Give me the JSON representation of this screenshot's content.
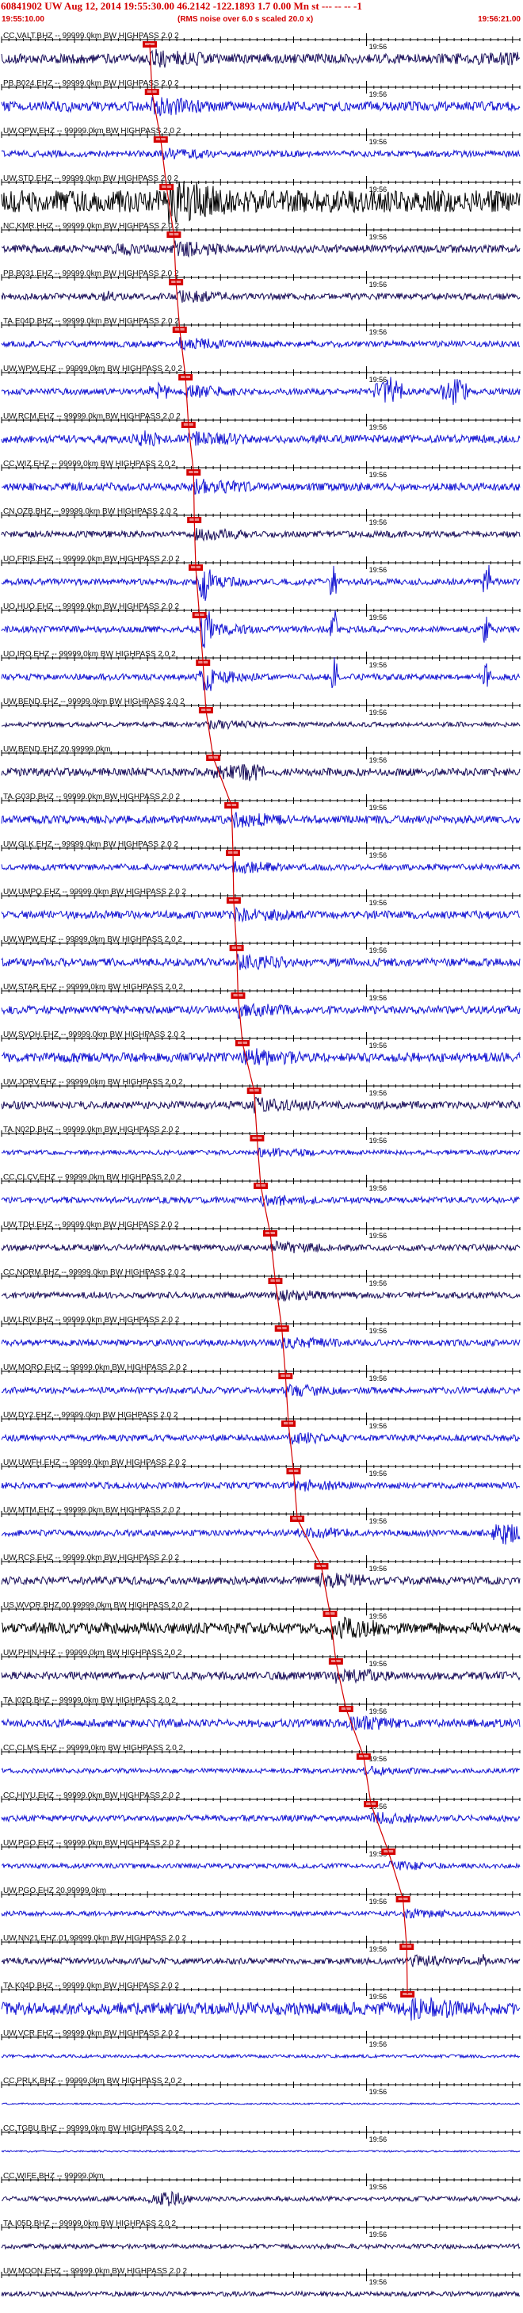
{
  "header": {
    "title": "60841902 UW Aug 12, 2014 19:55:30.00   46.2142 -122.1893  1.7 0.00 Mn st --- -- -- -1",
    "start_time": "19:55:10.00",
    "end_time": "19:56:21.00",
    "note": "(RMS noise over 6.0 s scaled 20.0 x)"
  },
  "colors": {
    "trace_primary": "#1414d2",
    "trace_dark": "#1a0f5a",
    "trace_black": "#000000",
    "pick": "#d40000",
    "axis": "#000000",
    "background": "#ffffff"
  },
  "chart_data": {
    "type": "seismogram-record-section",
    "title": "60841902 UW Aug 12, 2014 19:55:30.00   46.2142 -122.1893  1.7 0.00 Mn st --- -- -- -1",
    "x_range": [
      "19:55:10.00",
      "19:56:21.00"
    ],
    "minute_mark": "19:56",
    "grid": false,
    "channels": [
      {
        "label": "CC.VALT.BHZ -- 99999.0km BW  HIGHPASS  2.0  2",
        "pick": "19:55:30.3",
        "pick_label": "",
        "style": "dark",
        "amplitude": 6,
        "bursts": [
          [
            50,
            95,
            9
          ]
        ]
      },
      {
        "label": "PB.B024.EHZ -- 99999.0km BW  HIGHPASS  2.0  2",
        "pick": "19:55:30.6",
        "pick_label": "",
        "style": "blue",
        "amplitude": 6,
        "bursts": [
          [
            6,
            12,
            8
          ]
        ]
      },
      {
        "label": "UW.OPW.EHZ -- 99999.0km BW  HIGHPASS  2.0  2",
        "pick": "19:55:31.8",
        "pick_label": "",
        "style": "blue",
        "amplitude": 4,
        "bursts": [
          [
            80,
            90,
            8
          ]
        ]
      },
      {
        "label": "UW.STD.EHZ -- 99999.0km BW  HIGHPASS  2.0  2",
        "pick": "19:55:32.6",
        "pick_label": "",
        "style": "black",
        "amplitude": 14,
        "bursts": []
      },
      {
        "label": "NC.KMR.HHZ -- 99999.0km BW  HIGHPASS  2.0  2",
        "pick": "19:55:33.6",
        "pick_label": "",
        "style": "dark",
        "amplitude": 5,
        "bursts": [
          [
            14,
            20,
            9
          ]
        ]
      },
      {
        "label": "PB.B031.EHZ -- 99999.0km BW  HIGHPASS  2.0  2",
        "pick": "19:55:33.9",
        "pick_label": "",
        "style": "dark",
        "amplitude": 4,
        "bursts": [
          [
            13,
            16,
            8
          ]
        ]
      },
      {
        "label": "TA.E04D.BHZ -- 99999.0km BW  HIGHPASS  2.0  2",
        "pick": "19:55:34.4",
        "pick_label": "",
        "style": "blue",
        "amplitude": 4,
        "bursts": []
      },
      {
        "label": "UW.WPW.EHZ -- 99999.0km BW  HIGHPASS  2.0  2",
        "pick": "19:55:35.2",
        "pick_label": "",
        "style": "blue",
        "amplitude": 4,
        "bursts": [
          [
            20,
            23,
            14
          ],
          [
            51,
            55,
            20
          ],
          [
            60,
            64,
            18
          ]
        ]
      },
      {
        "label": "UW.RCM.EHZ -- 99999.0km BW  HIGHPASS  2.0  2",
        "pick": "19:55:35.6",
        "pick_label": "",
        "style": "blue",
        "amplitude": 5,
        "bursts": [
          [
            18,
            22,
            12
          ]
        ]
      },
      {
        "label": "CC.WIZ.EHZ -- 99999.0km BW  HIGHPASS  2.0  2",
        "pick": "19:55:36.3",
        "pick_label": "",
        "style": "blue",
        "amplitude": 5,
        "bursts": []
      },
      {
        "label": "CN.OZB.BHZ -- 99999.0km BW  HIGHPASS  2.0  2",
        "pick": "19:55:36.4",
        "pick_label": "",
        "style": "dark",
        "amplitude": 4,
        "bursts": []
      },
      {
        "label": "UO.FRIS.EHZ -- 99999.0km BW  HIGHPASS  2.0  2",
        "pick": "19:55:36.6",
        "pick_label": "",
        "style": "blue",
        "amplitude": 4,
        "bursts": [
          [
            27,
            29,
            30
          ],
          [
            45,
            46,
            30
          ],
          [
            66,
            67,
            30
          ]
        ]
      },
      {
        "label": "UO.HUO.EHZ -- 99999.0km BW  HIGHPASS  2.0  2",
        "pick": "19:55:37.1",
        "pick_label": "",
        "style": "blue",
        "amplitude": 4,
        "bursts": [
          [
            27,
            29,
            30
          ],
          [
            45,
            46,
            30
          ],
          [
            66,
            67,
            30
          ]
        ]
      },
      {
        "label": "UO.IRO.EHZ -- 99999.0km BW  HIGHPASS  2.0  2",
        "pick": "19:55:37.6",
        "pick_label": "",
        "style": "blue",
        "amplitude": 4,
        "bursts": [
          [
            27,
            29,
            30
          ],
          [
            45,
            46,
            30
          ],
          [
            66,
            67,
            30
          ]
        ]
      },
      {
        "label": "UW.BEND.EHZ -- 99999.0km BW  HIGHPASS  2.0  2",
        "pick": "19:55:38.0",
        "pick_label": "",
        "style": "dark",
        "amplitude": 3,
        "bursts": []
      },
      {
        "label": "UW.BEND.EHZ 20.99999.0km",
        "pick": "19:55:39.0",
        "pick_label": "",
        "style": "dark",
        "amplitude": 5,
        "bursts": [
          [
            32,
            36,
            14
          ]
        ]
      },
      {
        "label": "TA.G03D.BHZ -- 99999.0km BW  HIGHPASS  2.0  2",
        "pick": "19:55:41.5",
        "pick_label": "",
        "style": "blue",
        "amplitude": 5,
        "bursts": []
      },
      {
        "label": "UW.GLK.EHZ -- 99999.0km BW  HIGHPASS  2.0  2",
        "pick": "19:55:41.7",
        "pick_label": "",
        "style": "blue",
        "amplitude": 4,
        "bursts": []
      },
      {
        "label": "UW.UMPQ.EHZ -- 99999.0km BW  HIGHPASS  2.0  2",
        "pick": "19:55:41.8",
        "pick_label": "",
        "style": "blue",
        "amplitude": 5,
        "bursts": []
      },
      {
        "label": "UW.WPW.EHZ -- 99999.0km BW  HIGHPASS  2.0  2",
        "pick": "19:55:42.2",
        "pick_label": "",
        "style": "blue",
        "amplitude": 5,
        "bursts": []
      },
      {
        "label": "UW.STAR.EHZ -- 99999.0km BW  HIGHPASS  2.0  2",
        "pick": "19:55:42.4",
        "pick_label": "",
        "style": "blue",
        "amplitude": 5,
        "bursts": []
      },
      {
        "label": "UW.SVOH.EHZ -- 99999.0km BW  HIGHPASS  2.0  2",
        "pick": "19:55:43.0",
        "pick_label": "",
        "style": "blue",
        "amplitude": 6,
        "bursts": []
      },
      {
        "label": "UW.JORV.EHZ -- 99999.0km BW  HIGHPASS  2.0  2",
        "pick": "19:55:44.6",
        "pick_label": "",
        "style": "dark",
        "amplitude": 5,
        "bursts": []
      },
      {
        "label": "TA.N02D.BHZ -- 99999.0km BW  HIGHPASS  2.0  2",
        "pick": "19:55:45.0",
        "pick_label": "",
        "style": "blue",
        "amplitude": 3,
        "bursts": []
      },
      {
        "label": "CC.CLCV.EHZ -- 99999.0km BW  HIGHPASS  2.0  2",
        "pick": "19:55:45.5",
        "pick_label": "",
        "style": "blue",
        "amplitude": 4,
        "bursts": []
      },
      {
        "label": "UW.TDH.EHZ -- 99999.0km BW  HIGHPASS  2.0  2",
        "pick": "19:55:46.8",
        "pick_label": "",
        "style": "dark",
        "amplitude": 4,
        "bursts": []
      },
      {
        "label": "CC.NORM.BHZ -- 99999.0km BW  HIGHPASS  2.0  2",
        "pick": "19:55:47.5",
        "pick_label": "",
        "style": "dark",
        "amplitude": 4,
        "bursts": []
      },
      {
        "label": "UW.LRIV.BHZ -- 99999.0km BW  HIGHPASS  2.0  2",
        "pick": "19:55:48.4",
        "pick_label": "",
        "style": "blue",
        "amplitude": 4,
        "bursts": []
      },
      {
        "label": "UW.MORO.EHZ -- 99999.0km BW  HIGHPASS  2.0  2",
        "pick": "19:55:48.9",
        "pick_label": "",
        "style": "blue",
        "amplitude": 4,
        "bursts": []
      },
      {
        "label": "UW.DY2.EHZ -- 99999.0km BW  HIGHPASS  2.0  2",
        "pick": "19:55:49.3",
        "pick_label": "",
        "style": "blue",
        "amplitude": 4,
        "bursts": []
      },
      {
        "label": "UW.UWFH.EHZ -- 99999.0km BW  HIGHPASS  2.0  2",
        "pick": "19:55:50.0",
        "pick_label": "",
        "style": "blue",
        "amplitude": 4,
        "bursts": []
      },
      {
        "label": "UW.MTM.EHZ -- 99999.0km BW  HIGHPASS  2.0  2",
        "pick": "19:55:50.5",
        "pick_label": "",
        "style": "blue",
        "amplitude": 4,
        "bursts": [
          [
            67,
            71,
            16
          ]
        ]
      },
      {
        "label": "UW.RCS.EHZ -- 99999.0km BW  HIGHPASS  2.0  2",
        "pick": "19:55:53.8",
        "pick_label": "",
        "style": "dark",
        "amplitude": 5,
        "bursts": [
          [
            43,
            47,
            12
          ]
        ]
      },
      {
        "label": "US.WVOR.BHZ.00.99999.0km BW  HIGHPASS  2.0  2",
        "pick": "19:55:55.0",
        "pick_label": "",
        "style": "black",
        "amplitude": 7,
        "bursts": []
      },
      {
        "label": "UW.PHIN.HHZ -- 99999.0km BW  HIGHPASS  2.0  2",
        "pick": "19:55:55.8",
        "pick_label": "",
        "style": "dark",
        "amplitude": 5,
        "bursts": []
      },
      {
        "label": "TA.I02D.BHZ -- 99999.0km BW  HIGHPASS  2.0  2",
        "pick": "19:55:57.2",
        "pick_label": "",
        "style": "blue",
        "amplitude": 5,
        "bursts": []
      },
      {
        "label": "CC.CLMS.EHZ -- 99999.0km BW  HIGHPASS  2.0  2",
        "pick": "19:55:59.6",
        "pick_label": "",
        "style": "blue",
        "amplitude": 3,
        "bursts": []
      },
      {
        "label": "CC.HIYU.EHZ -- 99999.0km BW  HIGHPASS  2.0  2",
        "pick": "19:56:00.6",
        "pick_label": "",
        "style": "blue",
        "amplitude": 4,
        "bursts": []
      },
      {
        "label": "UW.PGO.EHZ -- 99999.0km BW  HIGHPASS  2.0  2",
        "pick": "19:56:03.0",
        "pick_label": "",
        "style": "blue",
        "amplitude": 3,
        "bursts": []
      },
      {
        "label": "UW.PGO.EHZ 20.99999.0km",
        "pick": "19:56:05.0",
        "pick_label": "",
        "style": "blue",
        "amplitude": 3,
        "bursts": []
      },
      {
        "label": "UW.NN21.EHZ.01.99999.0km BW  HIGHPASS  2.0  2",
        "pick": "19:56:05.5",
        "pick_label": "",
        "style": "dark",
        "amplitude": 4,
        "bursts": [
          [
            65,
            67,
            9
          ]
        ]
      },
      {
        "label": "TA.K04D.BHZ -- 99999.0km BW  HIGHPASS  2.0  2",
        "pick": "19:56:05.6",
        "pick_label": "",
        "style": "blue",
        "amplitude": 8,
        "bursts": []
      },
      {
        "label": "UW.VCR.EHZ -- 99999.0km BW  HIGHPASS  2.0  2",
        "pick": "",
        "pick_label": "",
        "style": "blue",
        "amplitude": 2,
        "bursts": []
      },
      {
        "label": "CC.PRLK.BHZ -- 99999.0km BW  HIGHPASS  2.0  2",
        "pick": "",
        "pick_label": "",
        "style": "blue",
        "amplitude": 1,
        "bursts": []
      },
      {
        "label": "CC.TGBU.BHZ -- 99999.0km BW  HIGHPASS  2.0  2",
        "pick": "",
        "pick_label": "",
        "style": "blue",
        "amplitude": 1,
        "bursts": []
      },
      {
        "label": "CC.WIFE.BHZ -- 99999.0km",
        "pick": "",
        "pick_label": "",
        "style": "dark",
        "amplitude": 3,
        "bursts": [
          [
            20,
            26,
            10
          ]
        ]
      },
      {
        "label": "TA.I05D.BHZ -- 99999.0km BW  HIGHPASS  2.0  2",
        "pick": "",
        "pick_label": "",
        "style": "dark",
        "amplitude": 3,
        "bursts": []
      },
      {
        "label": "UW.MOON.EHZ -- 99999.0km BW  HIGHPASS  2.0  2",
        "pick": "",
        "pick_label": "",
        "style": "dark",
        "amplitude": 3,
        "bursts": []
      }
    ]
  }
}
